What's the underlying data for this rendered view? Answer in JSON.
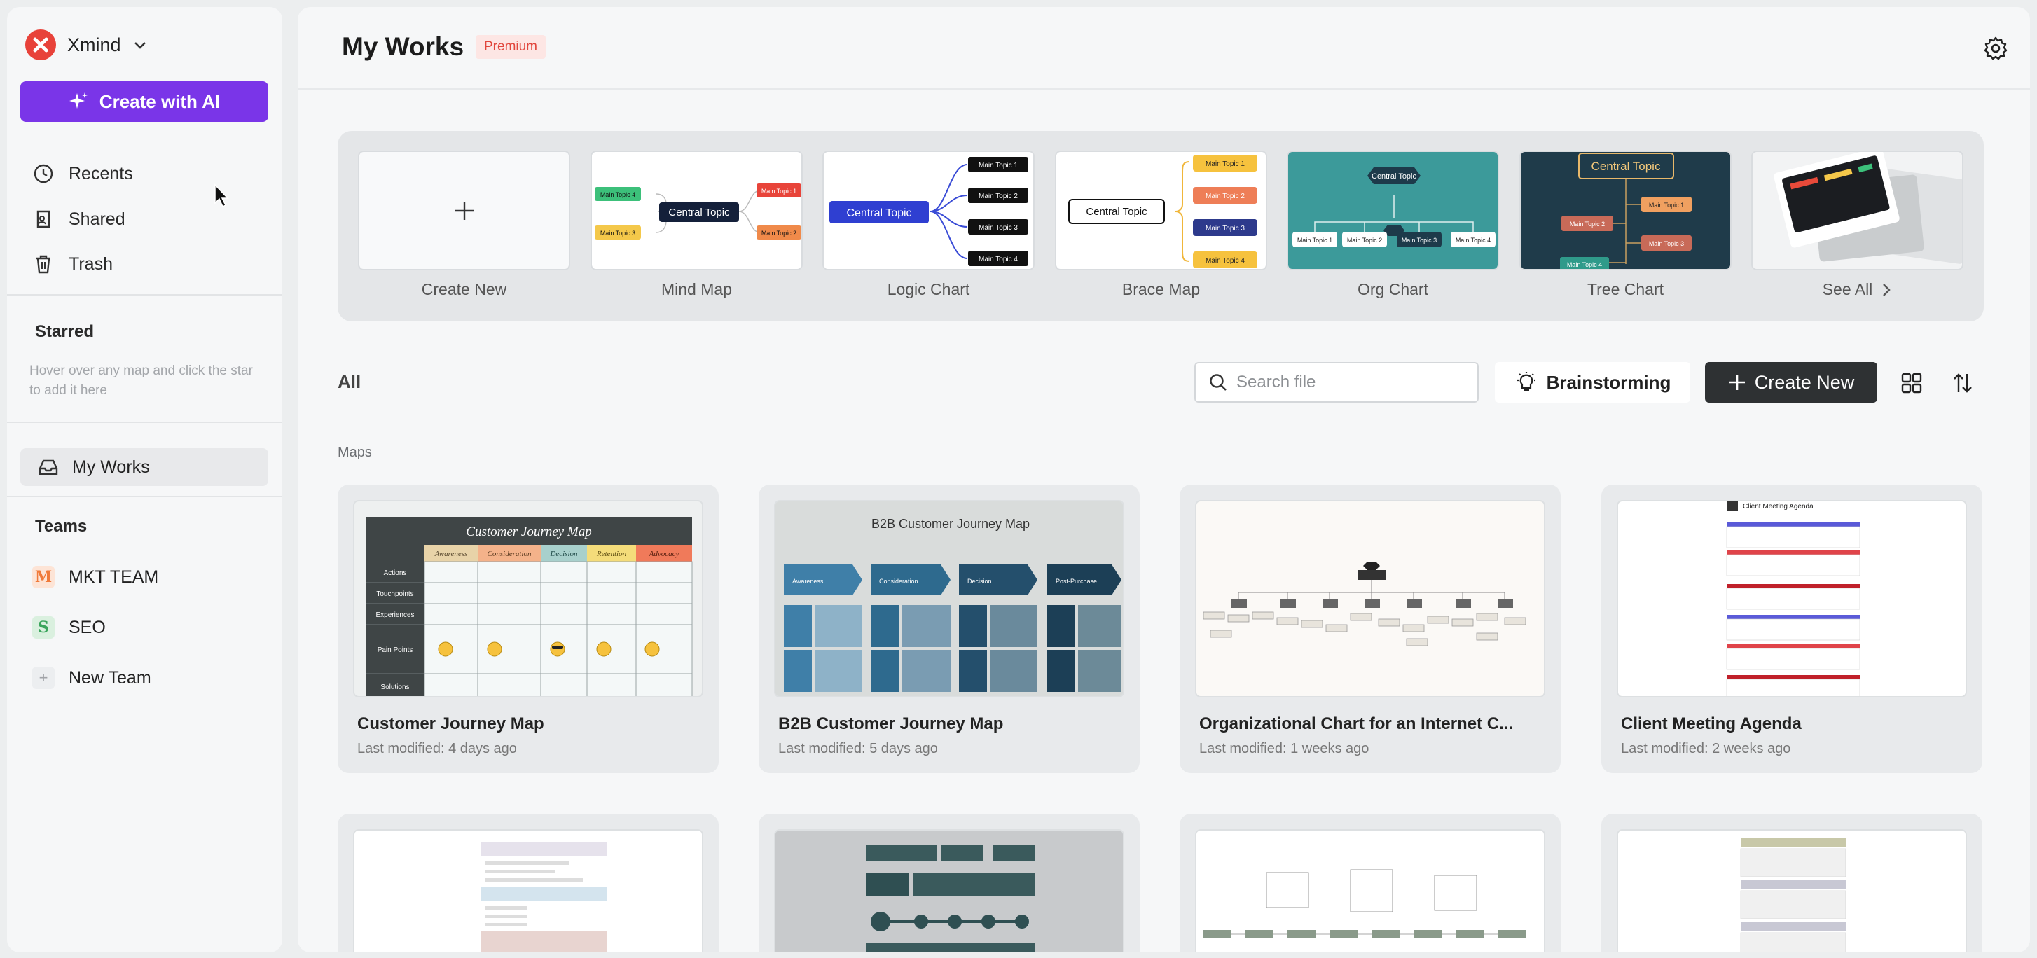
{
  "brand": {
    "name": "Xmind"
  },
  "sidebar": {
    "create_ai_label": "Create with AI",
    "nav": [
      {
        "label": "Recents",
        "icon": "clock-icon"
      },
      {
        "label": "Shared",
        "icon": "shared-icon"
      },
      {
        "label": "Trash",
        "icon": "trash-icon"
      }
    ],
    "starred_title": "Starred",
    "starred_hint": "Hover over any map and click the star to add it here",
    "my_works_label": "My Works",
    "teams_title": "Teams",
    "teams": [
      {
        "label": "MKT TEAM",
        "badge": "M",
        "badge_color": "#f07a3a"
      },
      {
        "label": "SEO",
        "badge": "S",
        "badge_color": "#3ba55c"
      },
      {
        "label": "New Team",
        "badge": "+",
        "badge_color": "#a0a3a7"
      }
    ]
  },
  "header": {
    "title": "My Works",
    "badge": "Premium"
  },
  "templates": [
    {
      "label": "Create New"
    },
    {
      "label": "Mind Map"
    },
    {
      "label": "Logic Chart"
    },
    {
      "label": "Brace Map"
    },
    {
      "label": "Org Chart"
    },
    {
      "label": "Tree Chart"
    },
    {
      "label": "See All"
    }
  ],
  "template_thumbs": {
    "central": "Central Topic",
    "main1": "Main Topic 1",
    "main2": "Main Topic 2",
    "main3": "Main Topic 3",
    "main4": "Main Topic 4"
  },
  "toolbar": {
    "all_label": "All",
    "search_placeholder": "Search file",
    "brainstorm_label": "Brainstorming",
    "create_new_label": "Create New"
  },
  "maps_label": "Maps",
  "files": [
    {
      "title": "Customer Journey Map",
      "modified": "Last modified: 4 days ago"
    },
    {
      "title": "B2B Customer Journey Map",
      "modified": "Last modified: 5 days ago"
    },
    {
      "title": "Organizational Chart for an Internet C...",
      "modified": "Last modified: 1 weeks ago"
    },
    {
      "title": "Client Meeting Agenda",
      "modified": "Last modified: 2 weeks ago"
    }
  ],
  "thumb_text": {
    "cjm_title": "Customer Journey Map",
    "cjm_stages": [
      "Awareness",
      "Consideration",
      "Decision",
      "Retention",
      "Advocacy"
    ],
    "cjm_rows": [
      "Actions",
      "Touchpoints",
      "Experiences",
      "Pain Points",
      "Solutions"
    ],
    "b2b_title": "B2B Customer Journey Map",
    "b2b_stages": [
      "Awareness",
      "Consideration",
      "Decision",
      "Post-Purchase"
    ],
    "agenda_title": "Client Meeting Agenda"
  },
  "colors": {
    "accent": "#7a35e8",
    "brand": "#e8423a",
    "premium": "#e1463c",
    "dark_button": "#2e3133"
  }
}
